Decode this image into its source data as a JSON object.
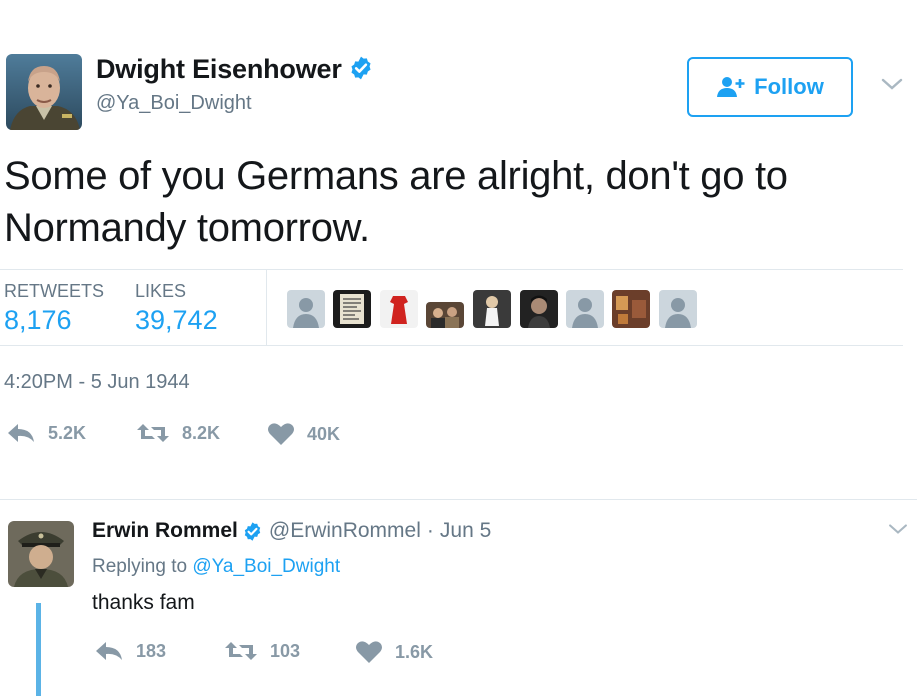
{
  "tweet": {
    "author_name": "Dwight Eisenhower",
    "author_handle": "@Ya_Boi_Dwight",
    "follow_label": "Follow",
    "text": "Some of you Germans are alright, don't go to Normandy tomorrow.",
    "stats": {
      "retweets_label": "RETWEETS",
      "retweets_value": "8,176",
      "likes_label": "LIKES",
      "likes_value": "39,742"
    },
    "timestamp": "4:20PM - 5 Jun 1944",
    "actions": {
      "reply_count": "5.2K",
      "retweet_count": "8.2K",
      "like_count": "40K"
    }
  },
  "reply": {
    "author_name": "Erwin Rommel",
    "author_handle": "@ErwinRommel",
    "separator": "·",
    "date": "Jun 5",
    "replying_to_prefix": "Replying to",
    "replying_to_handle": "@Ya_Boi_Dwight",
    "text": "thanks fam",
    "actions": {
      "reply_count": "183",
      "retweet_count": "103",
      "like_count": "1.6K"
    }
  },
  "colors": {
    "accent": "#1da1f2",
    "muted": "#657786",
    "icon_gray": "#8899a6",
    "thread_line": "#5bb3e6",
    "divider": "#e1e8ed"
  },
  "icons": [
    "verified-badge-icon",
    "follow-person-icon",
    "chevron-down-icon",
    "reply-icon",
    "retweet-icon",
    "heart-icon",
    "default-avatar-icon"
  ]
}
